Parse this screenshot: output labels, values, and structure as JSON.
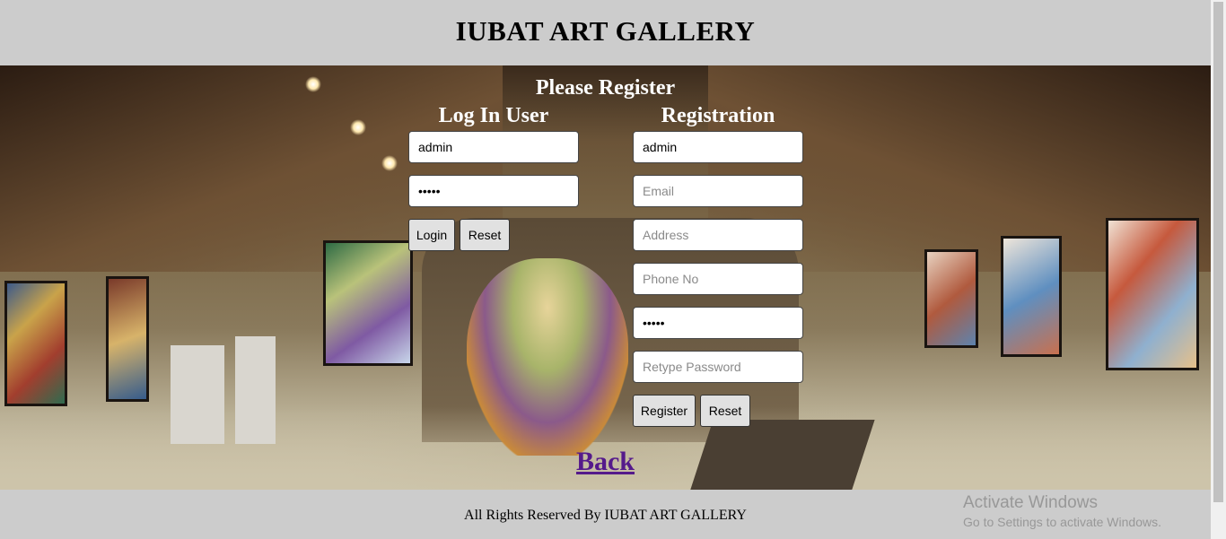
{
  "header": {
    "title": "IUBAT ART GALLERY"
  },
  "page": {
    "heading": "Please Register"
  },
  "login": {
    "title": "Log In User",
    "username_value": "admin",
    "password_value": "admin",
    "login_button": "Login",
    "reset_button": "Reset"
  },
  "registration": {
    "title": "Registration",
    "username_value": "admin",
    "email_placeholder": "Email",
    "address_placeholder": "Address",
    "phone_placeholder": "Phone No",
    "password_value": "admin",
    "retype_placeholder": "Retype Password",
    "register_button": "Register",
    "reset_button": "Reset"
  },
  "back_link": "Back",
  "footer": {
    "text": "All Rights Reserved By IUBAT ART GALLERY"
  },
  "watermark": {
    "line1": "Activate Windows",
    "line2": "Go to Settings to activate Windows."
  },
  "colors": {
    "header_bg": "#cccccc",
    "link": "#551a8b",
    "button_bg": "#e1e1e1"
  }
}
